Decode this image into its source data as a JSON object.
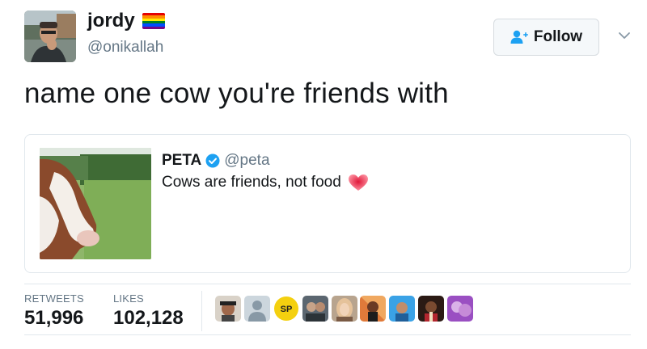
{
  "author": {
    "display_name": "jordy",
    "handle": "@onikallah",
    "avatar_icon": "user-photo-avatar",
    "flag_icon": "rainbow-flag-icon"
  },
  "follow_button": {
    "label": "Follow",
    "icon": "add-user-icon"
  },
  "menu_icon": "chevron-down-icon",
  "tweet": {
    "text": "name one cow you're friends with"
  },
  "quoted_tweet": {
    "name": "PETA",
    "verified": true,
    "handle": "@peta",
    "text": "Cows are friends, not food",
    "emoji": "heart-icon",
    "image": "cow-photo"
  },
  "stats": {
    "retweets_label": "RETWEETS",
    "retweets": "51,996",
    "likes_label": "LIKES",
    "likes": "102,128"
  },
  "likers": [
    "liker-avatar",
    "default-avatar",
    "sp-logo-avatar",
    "liker-avatar",
    "liker-avatar",
    "liker-avatar",
    "liker-avatar",
    "liker-avatar",
    "liker-avatar"
  ],
  "colors": {
    "text": "#14171a",
    "muted": "#657786",
    "border": "#e1e8ed",
    "verified": "#1da1f2",
    "follow_icon": "#1da1f2"
  }
}
